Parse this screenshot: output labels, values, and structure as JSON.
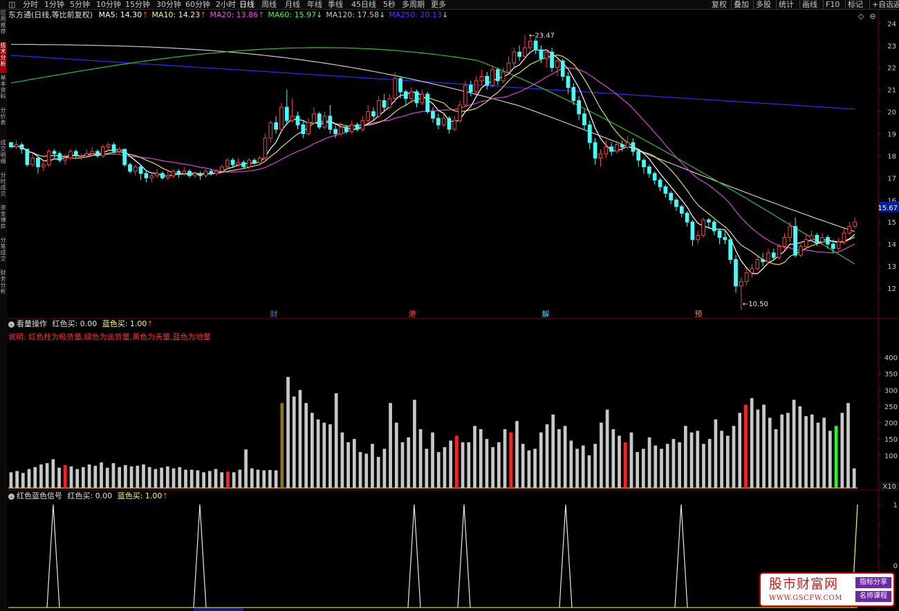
{
  "toolbar": {
    "periods": [
      "分时",
      "1分钟",
      "5分钟",
      "10分钟",
      "15分钟",
      "30分钟",
      "60分钟",
      "2小时",
      "日线",
      "周线",
      "月线",
      "年线",
      "季线",
      "45日线",
      "5秒",
      "多周期",
      "更多"
    ],
    "active_period": "日线",
    "right_buttons": [
      "复权",
      "叠加",
      "多股",
      "统计",
      "画线",
      "F10",
      "标记",
      "+自选",
      "返"
    ]
  },
  "sidebar": {
    "tabs": [
      "应用推荐",
      "技术分析",
      "基本资料",
      "分价表",
      "成交明细",
      "分时成交",
      "资金博弈",
      "分笔成交",
      "财务分析"
    ],
    "active_index": 1
  },
  "main_legend": {
    "stock_name": "东方通",
    "mode": "(日线,等比前复权)",
    "ma": [
      {
        "label": "MA5: 14.30",
        "color": "#ffffff",
        "arrow": "↑",
        "arrow_color": "#ff4040"
      },
      {
        "label": "MA10: 14.23",
        "color": "#ffff40",
        "arrow": "↑",
        "arrow_color": "#ff4040"
      },
      {
        "label": "MA20: 13.86",
        "color": "#ff40ff",
        "arrow": "↑",
        "arrow_color": "#ff4040"
      },
      {
        "label": "MA60: 15.97",
        "color": "#40ff40",
        "arrow": "↓",
        "arrow_color": "#40ffff"
      },
      {
        "label": "MA120: 17.58",
        "color": "#c8c8c8",
        "arrow": "↓",
        "arrow_color": "#40ffff"
      },
      {
        "label": "MA250: 20.13",
        "color": "#4040ff",
        "arrow": "↓",
        "arrow_color": "#40ffff"
      }
    ]
  },
  "price_axis": {
    "ticks": [
      "24",
      "23",
      "22",
      "21",
      "20",
      "19",
      "18",
      "17",
      "16",
      "15",
      "14",
      "13",
      "12"
    ],
    "current_price": "15.67",
    "high_label": "23.47",
    "low_label": "10.50"
  },
  "event_markers": [
    {
      "text": "财",
      "color": "#4080ff"
    },
    {
      "text": "港",
      "color": "#ff4040"
    },
    {
      "text": "解",
      "color": "#40d0ff"
    },
    {
      "text": "预",
      "color": "#ff8040"
    }
  ],
  "panel2": {
    "title": "看量操作",
    "red_buy": "红色买: 0.00",
    "blue_buy": "蓝色买: 1.00",
    "blue_arrow": "↑",
    "note": "说明: 红色柱为吸货量,绿色为出货量,黄色为天量,蓝色为地量",
    "axis_ticks": [
      "400",
      "350",
      "300",
      "250",
      "200",
      "150",
      "100"
    ],
    "unit_label": "X10"
  },
  "panel3": {
    "title": "红色蓝色信号",
    "red_buy": "红色买: 0.00",
    "blue_buy": "蓝色买: 1.00",
    "blue_arrow": "↑",
    "axis_ticks": [
      "1",
      "0"
    ]
  },
  "watermark": {
    "title": "股市财富网",
    "url": "WWW.GSCFW.COM",
    "tag1": "指标分享",
    "tag2": "名师课程"
  },
  "chart_data": {
    "type": "candlestick",
    "price_range": [
      10.5,
      23.47
    ],
    "candles": [
      [
        18.6,
        18.4,
        18.6,
        18.4
      ],
      [
        18.4,
        18.5,
        18.7,
        18.3
      ],
      [
        18.5,
        18.3,
        18.6,
        18.1
      ],
      [
        18.3,
        17.6,
        18.3,
        17.5
      ],
      [
        17.6,
        17.9,
        18.1,
        17.5
      ],
      [
        17.9,
        17.5,
        17.9,
        17.2
      ],
      [
        17.5,
        17.6,
        17.8,
        17.3
      ],
      [
        17.6,
        18.2,
        18.3,
        17.5
      ],
      [
        18.2,
        18.1,
        18.3,
        17.9
      ],
      [
        18.1,
        17.8,
        18.2,
        17.7
      ],
      [
        17.8,
        17.9,
        18.1,
        17.6
      ],
      [
        17.9,
        18.2,
        18.3,
        17.8
      ],
      [
        18.2,
        18.0,
        18.3,
        17.9
      ],
      [
        18.0,
        18.0,
        18.1,
        17.8
      ],
      [
        18.0,
        18.1,
        18.3,
        17.9
      ],
      [
        18.1,
        18.2,
        18.4,
        18.0
      ],
      [
        18.2,
        18.0,
        18.3,
        17.9
      ],
      [
        18.0,
        18.4,
        18.5,
        17.9
      ],
      [
        18.4,
        18.5,
        18.6,
        18.2
      ],
      [
        18.5,
        18.2,
        18.6,
        18.1
      ],
      [
        18.2,
        18.3,
        18.4,
        18.1
      ],
      [
        18.3,
        17.6,
        18.3,
        17.5
      ],
      [
        17.6,
        17.3,
        17.7,
        17.2
      ],
      [
        17.3,
        17.5,
        17.6,
        17.1
      ],
      [
        17.5,
        17.2,
        17.6,
        16.9
      ],
      [
        17.2,
        17.0,
        17.3,
        16.8
      ],
      [
        17.0,
        17.1,
        17.2,
        16.8
      ],
      [
        17.1,
        17.2,
        17.4,
        17.0
      ],
      [
        17.2,
        17.0,
        17.3,
        16.9
      ],
      [
        17.0,
        17.1,
        17.3,
        16.9
      ],
      [
        17.1,
        17.3,
        17.4,
        17.0
      ],
      [
        17.3,
        17.2,
        17.4,
        17.0
      ],
      [
        17.2,
        17.3,
        17.5,
        17.1
      ],
      [
        17.3,
        17.1,
        17.4,
        17.0
      ],
      [
        17.1,
        17.2,
        17.3,
        17.0
      ],
      [
        17.2,
        17.1,
        17.3,
        16.9
      ],
      [
        17.1,
        17.3,
        17.4,
        17.0
      ],
      [
        17.3,
        17.2,
        17.4,
        17.1
      ],
      [
        17.2,
        17.3,
        17.4,
        17.1
      ],
      [
        17.3,
        17.5,
        17.6,
        17.2
      ],
      [
        17.5,
        17.8,
        17.9,
        17.4
      ],
      [
        17.8,
        17.6,
        17.9,
        17.5
      ],
      [
        17.6,
        17.7,
        17.9,
        17.5
      ],
      [
        17.7,
        17.5,
        17.8,
        17.4
      ],
      [
        17.5,
        17.8,
        17.9,
        17.4
      ],
      [
        17.8,
        17.7,
        17.9,
        17.6
      ],
      [
        17.7,
        17.9,
        18.0,
        17.6
      ],
      [
        17.9,
        18.8,
        19.0,
        17.8
      ],
      [
        18.8,
        19.5,
        19.6,
        18.6
      ],
      [
        19.5,
        19.2,
        19.8,
        19.0
      ],
      [
        19.2,
        20.2,
        20.4,
        19.1
      ],
      [
        20.2,
        19.6,
        21.0,
        19.4
      ],
      [
        19.6,
        19.8,
        20.6,
        19.5
      ],
      [
        19.8,
        19.4,
        20.0,
        19.2
      ],
      [
        19.4,
        19.0,
        19.6,
        18.8
      ],
      [
        19.0,
        19.5,
        19.7,
        18.9
      ],
      [
        19.5,
        19.9,
        20.2,
        19.4
      ],
      [
        19.9,
        19.3,
        20.0,
        19.2
      ],
      [
        19.3,
        19.8,
        20.0,
        19.2
      ],
      [
        19.8,
        19.2,
        20.3,
        19.0
      ],
      [
        19.2,
        19.0,
        19.4,
        18.8
      ],
      [
        19.0,
        19.3,
        19.5,
        18.9
      ],
      [
        19.3,
        19.1,
        19.4,
        19.0
      ],
      [
        19.1,
        19.4,
        19.6,
        19.0
      ],
      [
        19.4,
        19.2,
        19.5,
        19.1
      ],
      [
        19.2,
        19.6,
        19.8,
        19.1
      ],
      [
        19.6,
        20.0,
        20.3,
        19.5
      ],
      [
        20.0,
        19.8,
        20.2,
        19.6
      ],
      [
        19.8,
        20.5,
        20.7,
        19.7
      ],
      [
        20.5,
        20.2,
        20.8,
        20.0
      ],
      [
        20.2,
        20.6,
        20.8,
        20.1
      ],
      [
        20.6,
        21.5,
        21.8,
        20.4
      ],
      [
        21.5,
        20.9,
        21.6,
        20.6
      ],
      [
        20.9,
        20.6,
        21.0,
        20.3
      ],
      [
        20.6,
        20.9,
        21.1,
        20.4
      ],
      [
        20.9,
        20.4,
        21.0,
        20.2
      ],
      [
        20.4,
        20.8,
        21.0,
        20.3
      ],
      [
        20.8,
        20.0,
        20.9,
        19.9
      ],
      [
        20.0,
        19.7,
        20.2,
        19.5
      ],
      [
        19.7,
        19.4,
        19.9,
        19.2
      ],
      [
        19.4,
        19.7,
        19.9,
        19.3
      ],
      [
        19.7,
        19.2,
        19.8,
        19.0
      ],
      [
        19.2,
        19.6,
        19.8,
        19.1
      ],
      [
        19.6,
        20.3,
        20.5,
        19.5
      ],
      [
        20.3,
        21.2,
        21.4,
        20.2
      ],
      [
        21.2,
        20.9,
        21.4,
        20.7
      ],
      [
        20.9,
        21.4,
        21.6,
        20.8
      ],
      [
        21.4,
        21.6,
        21.9,
        21.2
      ],
      [
        21.6,
        21.2,
        21.8,
        21.0
      ],
      [
        21.2,
        21.9,
        22.1,
        21.1
      ],
      [
        21.9,
        21.4,
        22.0,
        21.2
      ],
      [
        21.4,
        21.8,
        22.0,
        21.3
      ],
      [
        21.8,
        22.2,
        22.5,
        21.7
      ],
      [
        22.2,
        22.7,
        22.9,
        22.0
      ],
      [
        22.7,
        22.5,
        23.0,
        22.3
      ],
      [
        22.5,
        22.9,
        23.47,
        22.4
      ],
      [
        22.9,
        23.2,
        23.4,
        22.8
      ],
      [
        23.2,
        22.8,
        23.3,
        22.6
      ],
      [
        22.8,
        22.4,
        23.0,
        22.2
      ],
      [
        22.4,
        22.7,
        22.8,
        22.0
      ],
      [
        22.7,
        22.0,
        22.9,
        21.8
      ],
      [
        22.0,
        22.3,
        22.4,
        21.6
      ],
      [
        22.3,
        21.6,
        22.4,
        21.4
      ],
      [
        21.6,
        21.1,
        21.8,
        20.8
      ],
      [
        21.1,
        20.5,
        21.3,
        20.3
      ],
      [
        20.5,
        19.9,
        20.7,
        19.6
      ],
      [
        19.9,
        19.4,
        20.1,
        19.2
      ],
      [
        19.4,
        18.6,
        19.6,
        18.3
      ],
      [
        18.6,
        17.9,
        18.8,
        17.6
      ],
      [
        17.9,
        18.1,
        18.3,
        17.5
      ],
      [
        18.1,
        18.4,
        18.7,
        17.9
      ],
      [
        18.4,
        18.2,
        18.6,
        18.0
      ],
      [
        18.2,
        18.5,
        18.7,
        18.1
      ],
      [
        18.5,
        18.4,
        18.7,
        18.2
      ],
      [
        18.4,
        18.6,
        18.9,
        18.3
      ],
      [
        18.6,
        18.2,
        18.8,
        18.0
      ],
      [
        18.2,
        17.8,
        18.3,
        17.5
      ],
      [
        17.8,
        17.5,
        17.9,
        17.2
      ],
      [
        17.5,
        17.2,
        17.6,
        17.0
      ],
      [
        17.2,
        16.9,
        17.3,
        16.7
      ],
      [
        16.9,
        16.6,
        17.0,
        16.4
      ],
      [
        16.6,
        16.3,
        16.7,
        16.1
      ],
      [
        16.3,
        16.0,
        16.4,
        15.8
      ],
      [
        16.0,
        15.7,
        16.1,
        15.5
      ],
      [
        15.7,
        15.4,
        15.8,
        15.2
      ],
      [
        15.4,
        15.0,
        15.5,
        14.8
      ],
      [
        15.0,
        14.2,
        15.1,
        13.9
      ],
      [
        14.2,
        14.4,
        14.6,
        14.0
      ],
      [
        14.4,
        15.1,
        15.2,
        14.3
      ],
      [
        15.1,
        15.0,
        15.2,
        14.7
      ],
      [
        15.0,
        14.6,
        15.1,
        14.4
      ],
      [
        14.6,
        14.3,
        14.7,
        14.0
      ],
      [
        14.3,
        14.2,
        14.6,
        14.0
      ],
      [
        14.2,
        13.3,
        14.3,
        13.1
      ],
      [
        13.3,
        12.1,
        13.5,
        11.8
      ],
      [
        12.1,
        12.3,
        12.5,
        11.0
      ],
      [
        12.3,
        12.7,
        12.9,
        12.1
      ],
      [
        12.7,
        12.9,
        13.1,
        12.5
      ],
      [
        12.9,
        13.3,
        13.5,
        12.8
      ],
      [
        13.3,
        13.2,
        13.6,
        13.0
      ],
      [
        13.2,
        13.6,
        13.8,
        13.1
      ],
      [
        13.6,
        13.4,
        13.8,
        13.3
      ],
      [
        13.4,
        13.9,
        14.0,
        13.3
      ],
      [
        13.9,
        14.3,
        14.5,
        13.7
      ],
      [
        14.3,
        14.8,
        15.0,
        14.1
      ],
      [
        14.8,
        13.5,
        15.2,
        13.4
      ],
      [
        13.5,
        13.9,
        14.1,
        13.4
      ],
      [
        13.9,
        14.2,
        14.4,
        13.8
      ],
      [
        14.2,
        14.4,
        14.6,
        14.1
      ],
      [
        14.4,
        14.1,
        14.5,
        13.9
      ],
      [
        14.1,
        14.3,
        14.5,
        14.0
      ],
      [
        14.3,
        14.0,
        14.4,
        13.8
      ],
      [
        14.0,
        13.8,
        14.2,
        13.6
      ],
      [
        13.8,
        14.1,
        14.3,
        13.7
      ],
      [
        14.1,
        14.5,
        14.7,
        14.0
      ],
      [
        14.5,
        14.8,
        15.0,
        14.4
      ],
      [
        14.8,
        15.0,
        15.2,
        14.7
      ]
    ],
    "volumes": [
      48,
      52,
      46,
      58,
      64,
      72,
      76,
      88,
      62,
      70,
      66,
      58,
      64,
      72,
      68,
      78,
      62,
      76,
      64,
      70,
      66,
      68,
      72,
      64,
      58,
      62,
      66,
      60,
      64,
      56,
      56,
      54,
      48,
      52,
      58,
      48,
      50,
      48,
      56,
      118,
      60,
      56,
      54,
      55,
      54,
      260,
      340,
      280,
      300,
      260,
      230,
      210,
      200,
      195,
      290,
      170,
      140,
      150,
      110,
      105,
      135,
      95,
      120,
      260,
      200,
      140,
      155,
      270,
      180,
      120,
      170,
      110,
      125,
      145,
      160,
      140,
      140,
      190,
      180,
      150,
      125,
      140,
      180,
      170,
      205,
      135,
      115,
      120,
      170,
      195,
      225,
      180,
      190,
      145,
      120,
      130,
      100,
      135,
      200,
      240,
      180,
      160,
      140,
      170,
      110,
      120,
      155,
      130,
      120,
      135,
      150,
      140,
      190,
      170,
      175,
      135,
      150,
      210,
      175,
      160,
      190,
      230,
      255,
      275,
      240,
      255,
      215,
      180,
      225,
      230,
      270,
      250,
      220,
      225,
      200,
      215,
      175,
      190,
      230,
      260,
      60
    ],
    "volume_colors": [],
    "signal_positions": [
      9,
      36,
      74,
      83,
      102,
      122,
      154
    ]
  }
}
